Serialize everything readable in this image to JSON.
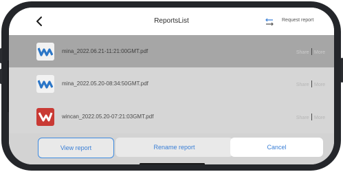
{
  "nav": {
    "back_icon": "chevron-left-icon",
    "title": "ReportsList",
    "request_icon": "swap-arrows-icon",
    "request_label": "Request report"
  },
  "reports": [
    {
      "name": "mina_2022.06.21-11:21:00GMT.pdf",
      "icon": "blue-w-logo-icon",
      "icon_color": "#f2f2f2",
      "glyph_color": "#2b76c7",
      "share": "Share",
      "more": "More",
      "selected": true
    },
    {
      "name": "mina_2022.05.20-08:34:50GMT.pdf",
      "icon": "blue-w-logo-icon",
      "icon_color": "#f2f2f2",
      "glyph_color": "#2b76c7",
      "share": "Share",
      "more": "More",
      "selected": false
    },
    {
      "name": "wincan_2022.05.20-07:21:03GMT.pdf",
      "icon": "red-v-logo-icon",
      "icon_color": "#c93a34",
      "glyph_color": "#ffffff",
      "share": "Share",
      "more": "More",
      "selected": false
    }
  ],
  "sheet": {
    "view_label": "View report",
    "rename_label": "Rename report",
    "cancel_label": "Cancel"
  },
  "colors": {
    "accent": "#3a7fd6",
    "selected_row": "#a6a6a6"
  }
}
